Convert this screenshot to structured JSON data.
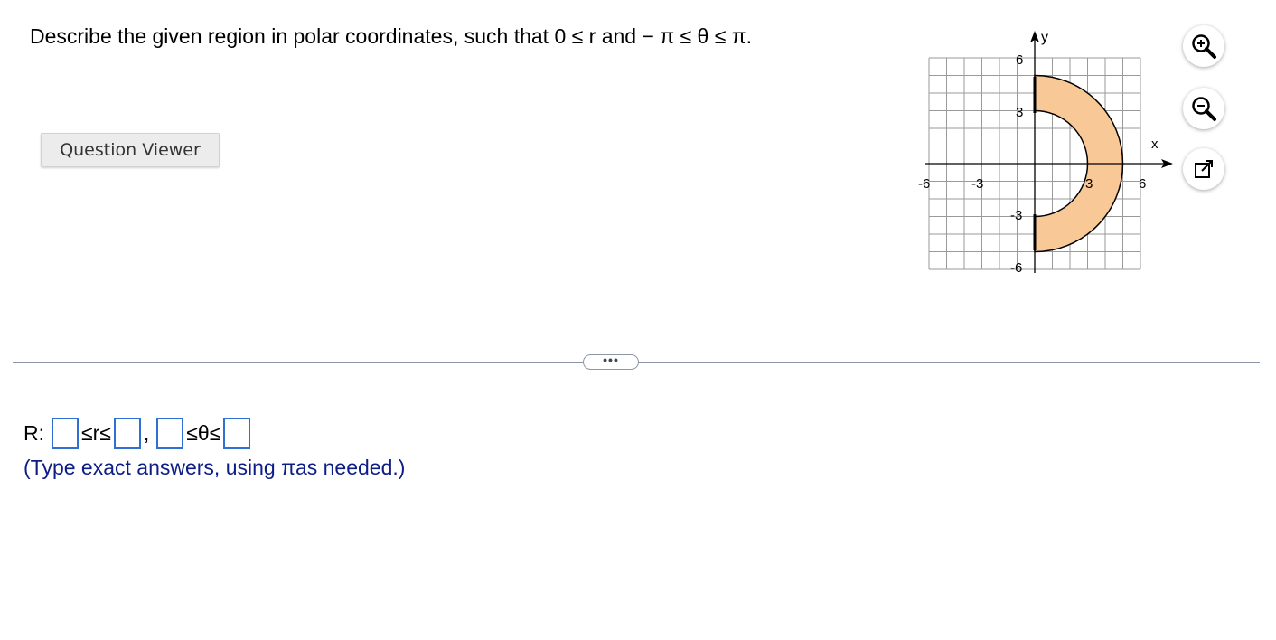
{
  "question": {
    "text": "Describe the given region in polar coordinates, such that 0 ≤ r and − π ≤ θ ≤ π."
  },
  "question_viewer_label": "Question Viewer",
  "graph": {
    "x_axis_label": "x",
    "y_axis_label": "y",
    "x_tick_labels": [
      "-6",
      "-3",
      "3",
      "6"
    ],
    "y_tick_labels": [
      "6",
      "3",
      "-3",
      "-6"
    ],
    "region": {
      "inner_radius": 3,
      "outer_radius": 5,
      "theta_start": "-π/2",
      "theta_end": "π/2"
    },
    "fill_color": "#f8c896",
    "grid_color": "#9a9a9a"
  },
  "tools": {
    "zoom_in_icon": "zoom-in-icon",
    "zoom_out_icon": "zoom-out-icon",
    "popout_icon": "popout-icon"
  },
  "more_label": "•••",
  "answer": {
    "prefix": "R:",
    "sym_r": "≤r≤",
    "comma": ",",
    "sym_theta": "≤θ≤",
    "box_values": [
      "",
      "",
      "",
      ""
    ]
  },
  "hint": "(Type exact answers, using πas needed.)",
  "colors": {
    "input_border": "#2f6fd6",
    "hint_text": "#0d1d86"
  }
}
